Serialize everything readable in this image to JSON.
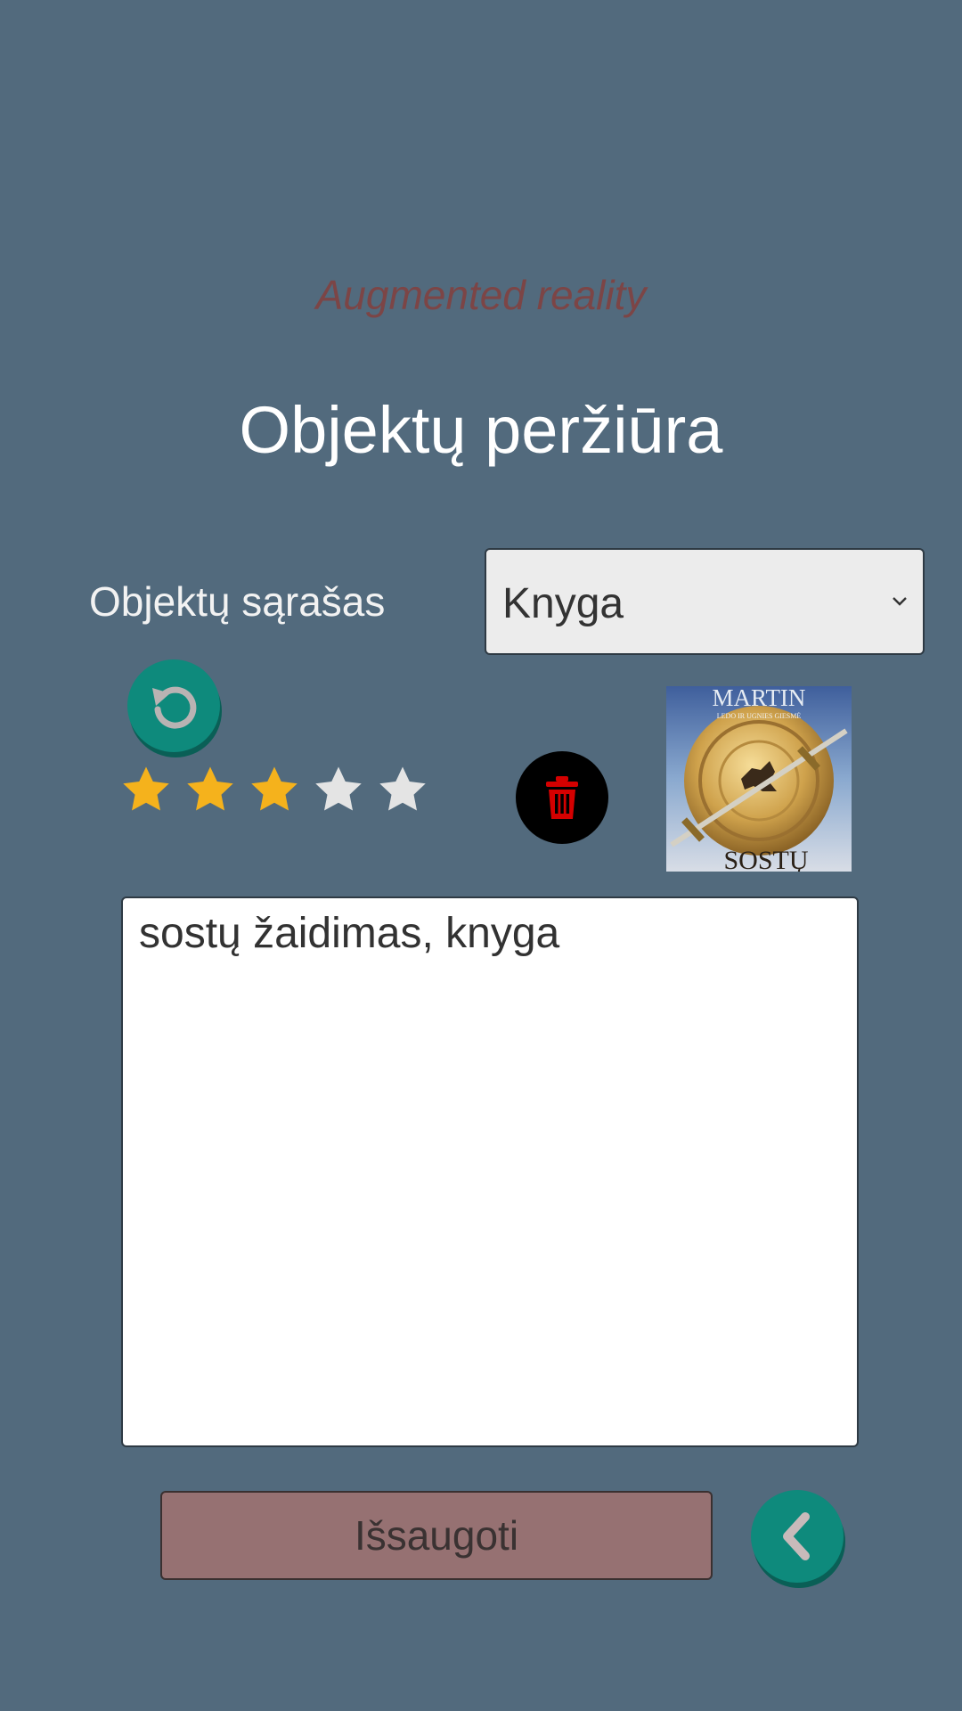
{
  "header": {
    "subtitle": "Augmented reality",
    "title": "Objektų peržiūra"
  },
  "object_list": {
    "label": "Objektų sąrašas",
    "selected": "Knyga"
  },
  "rating": {
    "value": 3,
    "max": 5
  },
  "cover": {
    "top_text": "MARTIN",
    "series_text": "LEDO IR UGNIES GIESMĖ",
    "bottom_text": "SOSTŲ"
  },
  "description": {
    "value": "sostų žaidimas, knyga"
  },
  "actions": {
    "save_label": "Išsaugoti"
  },
  "colors": {
    "background": "#526a7d",
    "accent_teal": "#0e8a7c",
    "subtitle": "#7c4546",
    "save_button": "#967172",
    "star_filled": "#f5b21c",
    "star_empty": "#e4e4e4",
    "delete_icon": "#d40000"
  },
  "icons": {
    "refresh": "refresh-icon",
    "delete": "trash-icon",
    "back": "chevron-left-icon",
    "dropdown": "chevron-down-icon"
  }
}
